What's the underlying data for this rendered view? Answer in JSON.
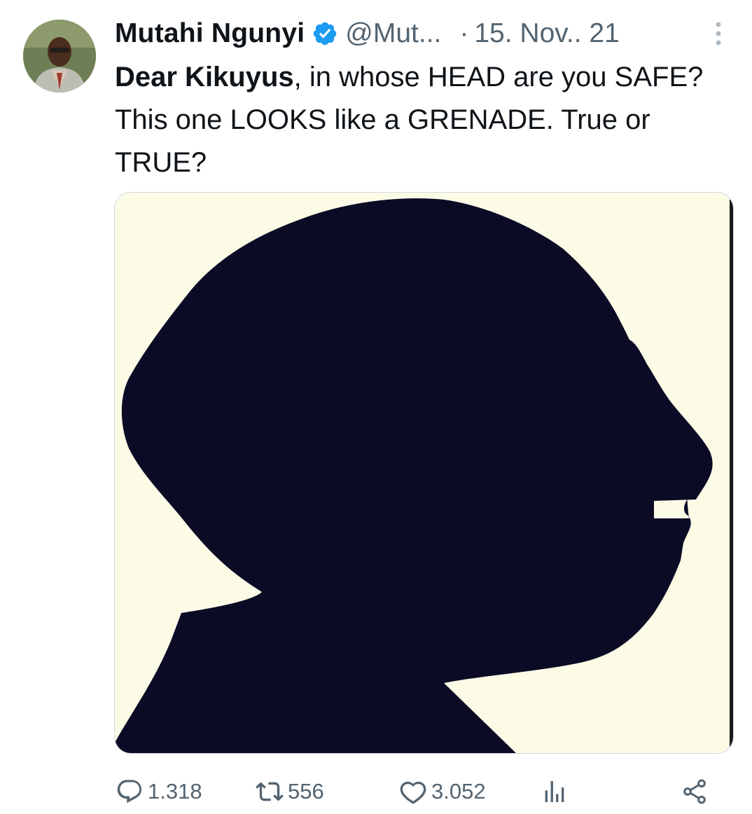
{
  "tweet": {
    "author_name": "Mutahi Ngunyi",
    "author_handle": "@Mut...",
    "separator": "·",
    "date": "15. Nov.. 21",
    "text_bold": "Dear Kikuyus",
    "text_rest": ", in whose HEAD are you SAFE? This one LOOKS like a GRENADE. True or TRUE?"
  },
  "actions": {
    "replies": "1.318",
    "retweets": "556",
    "likes": "3.052"
  },
  "icons": {
    "verified": "verified-badge-icon",
    "more": "more-vertical-icon",
    "reply": "reply-bubble-icon",
    "retweet": "retweet-icon",
    "like": "heart-icon",
    "views": "bar-chart-icon",
    "share": "share-nodes-icon"
  },
  "colors": {
    "text": "#0f1419",
    "secondary": "#536471",
    "verified": "#1d9bf0",
    "media_background": "#fbfbe6",
    "silhouette": "#0c0b26"
  }
}
